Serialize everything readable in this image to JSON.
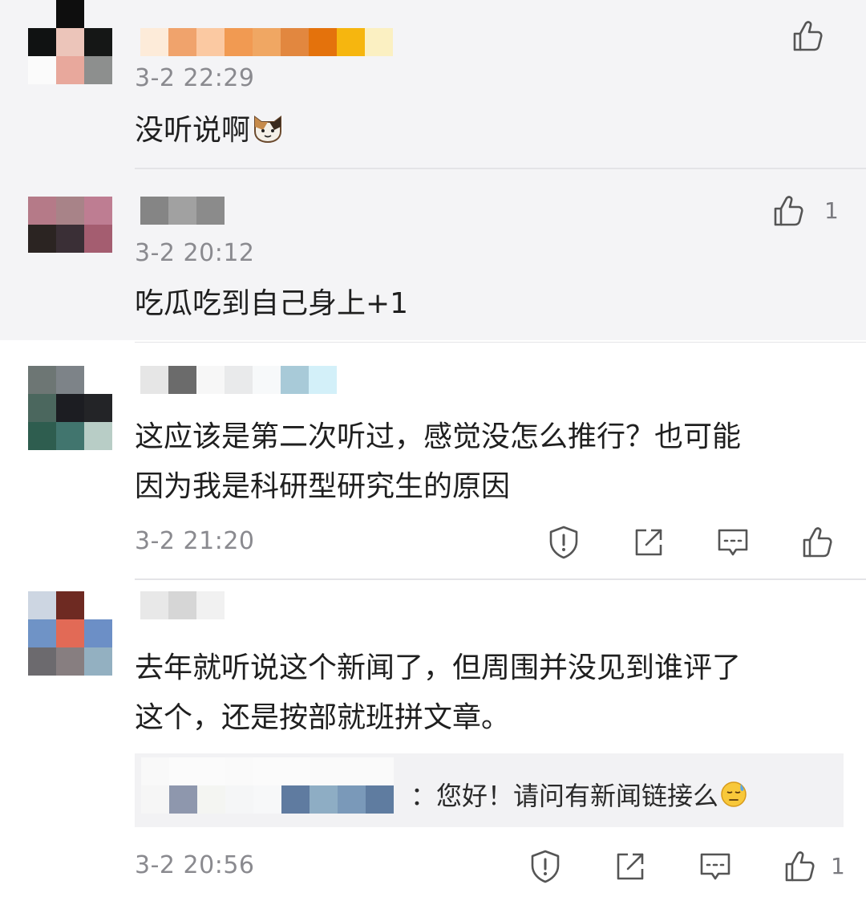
{
  "comments": [
    {
      "time": "3-2 22:29",
      "text": "没听说啊",
      "like_count": "",
      "emoji": "cat-face"
    },
    {
      "time": "3-2 20:12",
      "text": "吃瓜吃到自己身上+1",
      "like_count": "1"
    },
    {
      "time": "3-2 21:20",
      "text_line1": "这应该是第二次听过，感觉没怎么推行？也可能",
      "text_line2": "因为我是科研型研究生的原因"
    },
    {
      "time": "3-2 20:56",
      "text_line1": "去年就听说这个新闻了，但周围并没见到谁评了",
      "text_line2": "这个，还是按部就班拼文章。",
      "reply_text": "：您好！请问有新闻链接么",
      "like_count": "1"
    }
  ],
  "icons": {
    "like": "thumbs-up-icon",
    "report": "shield-exclamation-icon",
    "share": "share-icon",
    "reply": "comment-icon",
    "emoji_cat": "cat-emoji",
    "emoji_sweat": "sweat-emoji"
  },
  "colors": {
    "section_gray": "#f4f4f6",
    "text": "#1f1f1f",
    "meta": "#8a8a8f",
    "divider": "#e4e4e7"
  }
}
